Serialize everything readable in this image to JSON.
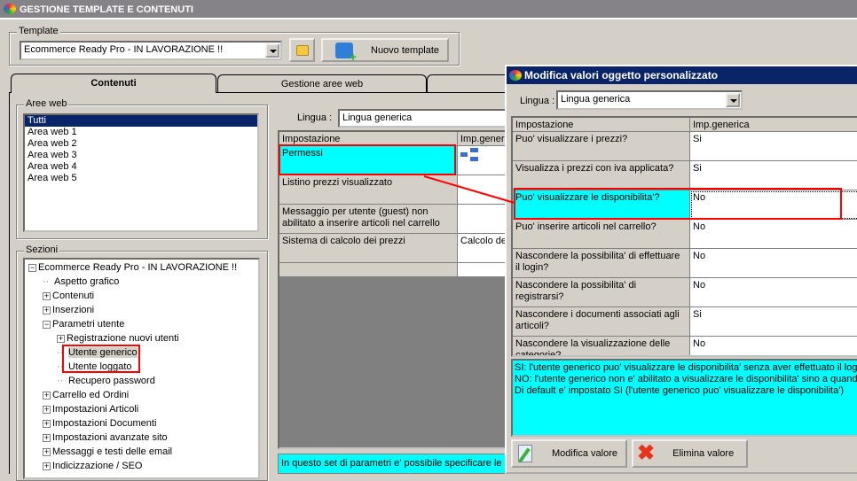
{
  "window": {
    "title": "GESTIONE TEMPLATE E CONTENUTI"
  },
  "template": {
    "group_label": "Template",
    "selected": "Ecommerce Ready Pro - IN LAVORAZIONE !!",
    "new_button": "Nuovo template"
  },
  "tabs": [
    {
      "label": "Contenuti",
      "active": true
    },
    {
      "label": "Gestione aree web"
    },
    {
      "label": ""
    }
  ],
  "aree_web": {
    "label": "Aree web",
    "items": [
      "Tutti",
      "Area web 1",
      "Area web 2",
      "Area web 3",
      "Area web 4",
      "Area web 5"
    ],
    "selected": "Tutti"
  },
  "sezioni": {
    "label": "Sezioni",
    "items": [
      {
        "label": "Ecommerce Ready Pro - IN LAVORAZIONE !!",
        "level": 0,
        "expander": "-"
      },
      {
        "label": "Aspetto grafico",
        "level": 1,
        "expander": ""
      },
      {
        "label": "Contenuti",
        "level": 1,
        "expander": "+"
      },
      {
        "label": "Inserzioni",
        "level": 1,
        "expander": "+"
      },
      {
        "label": "Parametri utente",
        "level": 1,
        "expander": "-"
      },
      {
        "label": "Registrazione nuovi utenti",
        "level": 2,
        "expander": "+"
      },
      {
        "label": "Utente generico",
        "level": 2,
        "expander": "",
        "selected": true
      },
      {
        "label": "Utente loggato",
        "level": 2,
        "expander": ""
      },
      {
        "label": "Recupero password",
        "level": 2,
        "expander": ""
      },
      {
        "label": "Carrello ed Ordini",
        "level": 1,
        "expander": "+"
      },
      {
        "label": "Impostazioni Articoli",
        "level": 1,
        "expander": "+"
      },
      {
        "label": "Impostazioni Documenti",
        "level": 1,
        "expander": "+"
      },
      {
        "label": "Impostazioni avanzate sito",
        "level": 1,
        "expander": "+"
      },
      {
        "label": "Messaggi e testi delle email",
        "level": 1,
        "expander": "+"
      },
      {
        "label": "Indicizzazione / SEO",
        "level": 1,
        "expander": "+"
      }
    ]
  },
  "main": {
    "lingua_label": "Lingua :",
    "lingua_value": "Lingua generica",
    "columns": [
      "Impostazione",
      "Imp.gener"
    ],
    "rows": [
      {
        "name": "Permessi",
        "value": "",
        "icon": "hierarchy-icon"
      },
      {
        "name": "Listino prezzi visualizzato",
        "value": ""
      },
      {
        "name": "Messaggio per utente (guest) non abilitato a inserire articoli nel carrello",
        "value": ""
      },
      {
        "name": "Sistema di calcolo dei prezzi",
        "value": "Calcolo de"
      }
    ],
    "info": "In questo set di parametri e' possibile specificare le a"
  },
  "dialog": {
    "title": "Modifica valori oggetto personalizzato",
    "lingua_label": "Lingua :",
    "lingua_value": "Lingua generica",
    "columns": [
      "Impostazione",
      "Imp.generica"
    ],
    "rows": [
      {
        "name": "Puo' visualizzare i prezzi?",
        "value": "Si"
      },
      {
        "name": "Visualizza i prezzi con iva applicata?",
        "value": "Si"
      },
      {
        "name": "Puo' visualizzare le disponibilita'?",
        "value": "No",
        "selected": true
      },
      {
        "name": "Puo' inserire articoli nel carrello?",
        "value": "No"
      },
      {
        "name": "Nascondere la possibilita' di effettuare il login?",
        "value": "No"
      },
      {
        "name": "Nascondere la possibilita' di registrarsi?",
        "value": "No"
      },
      {
        "name": "Nascondere i documenti associati agli articoli?",
        "value": "Si"
      },
      {
        "name": "Nascondere la visualizzazione delle categorie?",
        "value": "No"
      }
    ],
    "description": [
      "SI: l'utente generico puo' visualizzare le disponibilita' senza aver effettuato il login",
      "NO: l'utente generico non e' abilitato a visualizzare le disponibilita' sino a quando n",
      "Di default e' impostato SI (l'utente generico puo' visualizzare le disponibilita')"
    ],
    "edit_button": "Modifica valore",
    "delete_button": "Elimina valore"
  },
  "colors": {
    "highlight": "#00ffff",
    "annotation": "#ff0000",
    "dialog_title": "#0a246a"
  }
}
